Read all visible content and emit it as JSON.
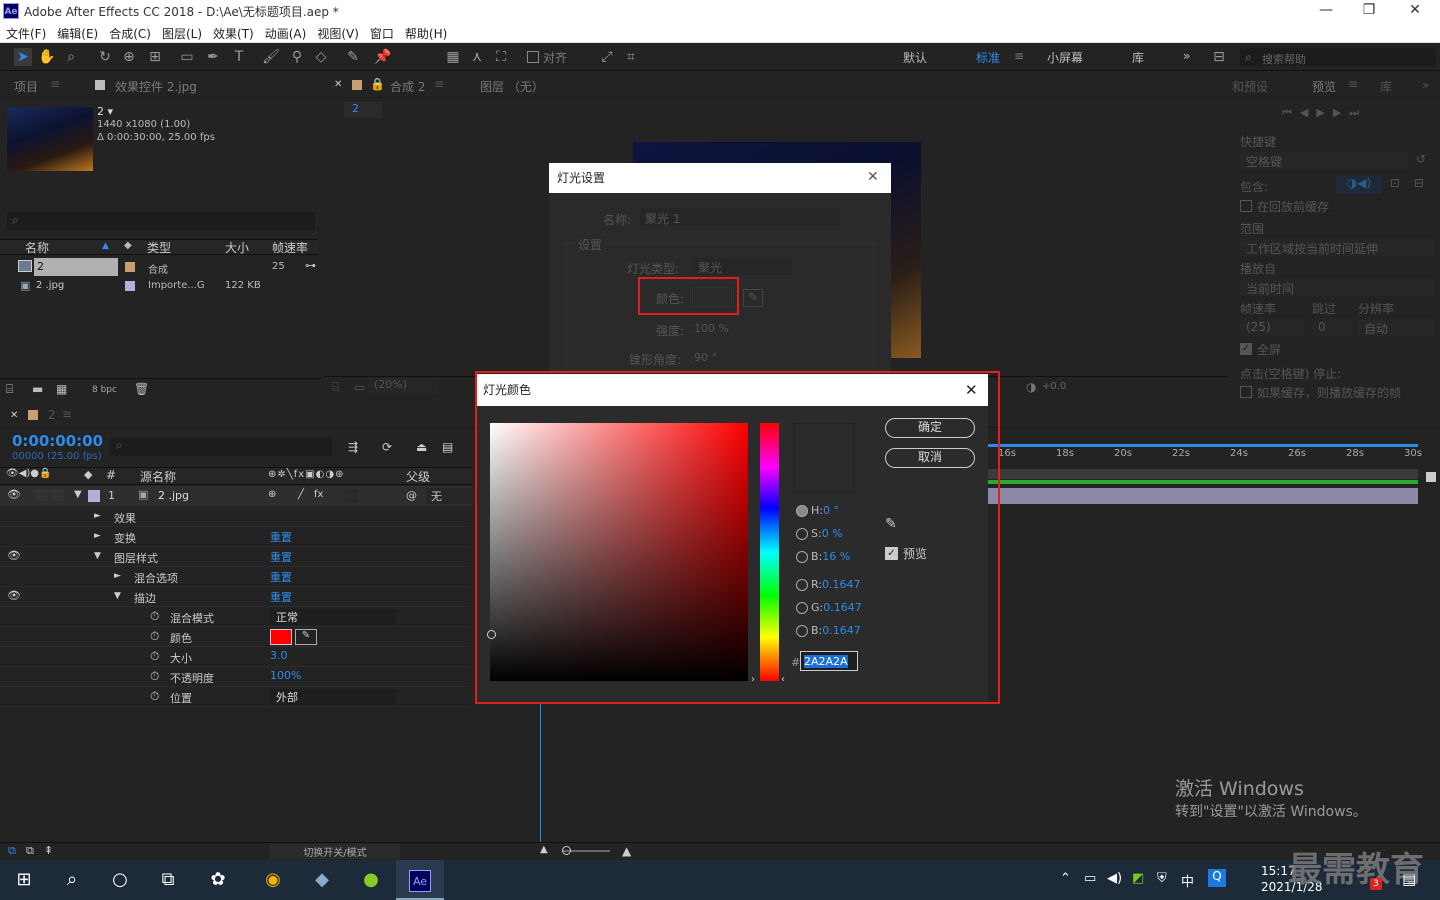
{
  "window": {
    "title": "Adobe After Effects CC 2018 - D:\\Ae\\无标题项目.aep *",
    "logo": "Ae",
    "min": "—",
    "max": "❐",
    "close": "✕"
  },
  "menu": [
    "文件(F)",
    "编辑(E)",
    "合成(C)",
    "图层(L)",
    "效果(T)",
    "动画(A)",
    "视图(V)",
    "窗口",
    "帮助(H)"
  ],
  "toolbar": {
    "snap_label": "对齐",
    "workspaces": [
      "默认",
      "标准",
      "小屏幕",
      "库"
    ],
    "active_ws": "标准",
    "more": "»",
    "search_placeholder": "搜索帮助"
  },
  "project": {
    "tab_project": "项目",
    "tab_effects": "效果控件 2.jpg",
    "item_name": "2 ▾",
    "item_res": "1440 x1080 (1.00)",
    "item_dur": "Δ 0:00:30:00, 25.00 fps",
    "search_icon": "🔍",
    "cols": [
      "名称",
      "类型",
      "大小",
      "帧速率"
    ],
    "rows": [
      {
        "name": "2",
        "type": "合成",
        "size": "",
        "fps": "25"
      },
      {
        "name": "2 .jpg",
        "type": "Importe...G",
        "size": "122 KB",
        "fps": ""
      }
    ],
    "bpc": "8 bpc"
  },
  "comp": {
    "tab": "合成 2",
    "layer_tab": "图层 （无）",
    "sub_tab": "2",
    "zoom": "(20%)",
    "offset": "+0.0"
  },
  "light_settings": {
    "title": "灯光设置",
    "name_label": "名称:",
    "name_value": "聚光 1",
    "settings_label": "设置",
    "type_label": "灯光类型:",
    "type_value": "聚光",
    "color_label": "颜色:",
    "intensity_label": "强度:",
    "intensity_value": "100 %",
    "cone_label": "锥形角度:",
    "cone_value": "90 °"
  },
  "color_picker": {
    "title": "灯光颜色",
    "ok": "确定",
    "cancel": "取消",
    "preview": "预览",
    "hsb": [
      {
        "k": "H:",
        "v": "0 °"
      },
      {
        "k": "S:",
        "v": "0 %"
      },
      {
        "k": "B:",
        "v": "16 %"
      }
    ],
    "rgb": [
      {
        "k": "R:",
        "v": "0.1647"
      },
      {
        "k": "G:",
        "v": "0.1647"
      },
      {
        "k": "B:",
        "v": "0.1647"
      }
    ],
    "hex_prefix": "#",
    "hex": "2A2A2A",
    "swatch": "#2a2a2a"
  },
  "preview_panel": {
    "tab1": "和预设",
    "tab2": "预览",
    "tab3": "库",
    "shortcut_label": "快捷键",
    "shortcut_value": "空格键",
    "include_label": "包含:",
    "cache_label": "在回放前缓存",
    "range_label": "范围",
    "range_value": "工作区域按当前时间延伸",
    "play_from_label": "播放自",
    "play_from_value": "当前时间",
    "fr_label": "帧速率",
    "skip_label": "跳过",
    "res_label": "分辨率",
    "fr_value": "(25)",
    "skip_value": "0",
    "res_value": "自动",
    "fullscreen": "全屏",
    "stop_label": "点击(空格键) 停止:",
    "if_cache": "如果缓存，则播放缓存的帧"
  },
  "timeline": {
    "timecode": "0:00:00:00",
    "timecode_sub": "00000 (25.00 fps)",
    "col_source": "源名称",
    "col_parent": "父级",
    "layer_num": "1",
    "layer_name": "2 .jpg",
    "parent_value": "无",
    "props": [
      {
        "label": "效果",
        "val": "",
        "ind": 1,
        "arrow": "►"
      },
      {
        "label": "变换",
        "val": "重置",
        "ind": 1,
        "arrow": "►"
      },
      {
        "label": "图层样式",
        "val": "重置",
        "ind": 1,
        "arrow": "▼"
      },
      {
        "label": "混合选项",
        "val": "重置",
        "ind": 2,
        "arrow": "►"
      },
      {
        "label": "描边",
        "val": "重置",
        "ind": 2,
        "arrow": "▼"
      },
      {
        "label": "混合模式",
        "val": "正常",
        "ind": 3,
        "arrow": ""
      },
      {
        "label": "颜色",
        "val": "",
        "ind": 3,
        "arrow": ""
      },
      {
        "label": "大小",
        "val": "3.0",
        "ind": 3,
        "arrow": ""
      },
      {
        "label": "不透明度",
        "val": "100%",
        "ind": 3,
        "arrow": ""
      },
      {
        "label": "位置",
        "val": "外部",
        "ind": 3,
        "arrow": ""
      }
    ],
    "ruler": [
      "16s",
      "18s",
      "20s",
      "22s",
      "24s",
      "26s",
      "28s",
      "30s"
    ],
    "toggle_label": "切换开关/模式"
  },
  "activate": {
    "line1": "激活 Windows",
    "line2": "转到\"设置\"以激活 Windows。"
  },
  "taskbar": {
    "time": "15:17",
    "date": "2021/1/28",
    "ime": "中",
    "watermark": "最需教育",
    "notify_count": "3"
  }
}
